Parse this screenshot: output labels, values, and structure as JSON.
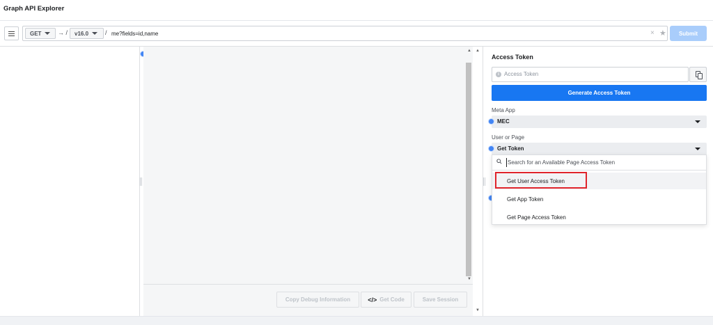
{
  "app": {
    "title": "Graph API Explorer"
  },
  "toolbar": {
    "method": "GET",
    "arrow": "→ /",
    "version": "v16.0",
    "slash": "/",
    "path": "me?fields=id,name",
    "clear": "×",
    "star": "★",
    "submit_label": "Submit",
    "colors": {
      "submit_disabled": "#a9cdfb",
      "border": "#ccd0d5"
    }
  },
  "editor": {
    "buttons": {
      "copy_debug": "Copy Debug Information",
      "get_code_glyph": "</>",
      "get_code": "Get Code",
      "save_session": "Save Session"
    }
  },
  "access_panel": {
    "title": "Access Token",
    "token_placeholder": "Access Token",
    "info_glyph": "i",
    "generate_label": "Generate Access Token",
    "meta_app_label": "Meta App",
    "meta_app_value": "MEC",
    "user_or_page_label": "User or Page",
    "user_or_page_value": "Get Token",
    "search_placeholder": "Search for an Available Page Access Token",
    "options": [
      {
        "label": "Get User Access Token",
        "highlighted": true
      },
      {
        "label": "Get App Token",
        "highlighted": false
      },
      {
        "label": "Get Page Access Token",
        "highlighted": false
      }
    ],
    "colors": {
      "primary": "#1877f2",
      "highlight_box": "#e0242b",
      "dropdown_bg": "#ebedf0"
    }
  }
}
